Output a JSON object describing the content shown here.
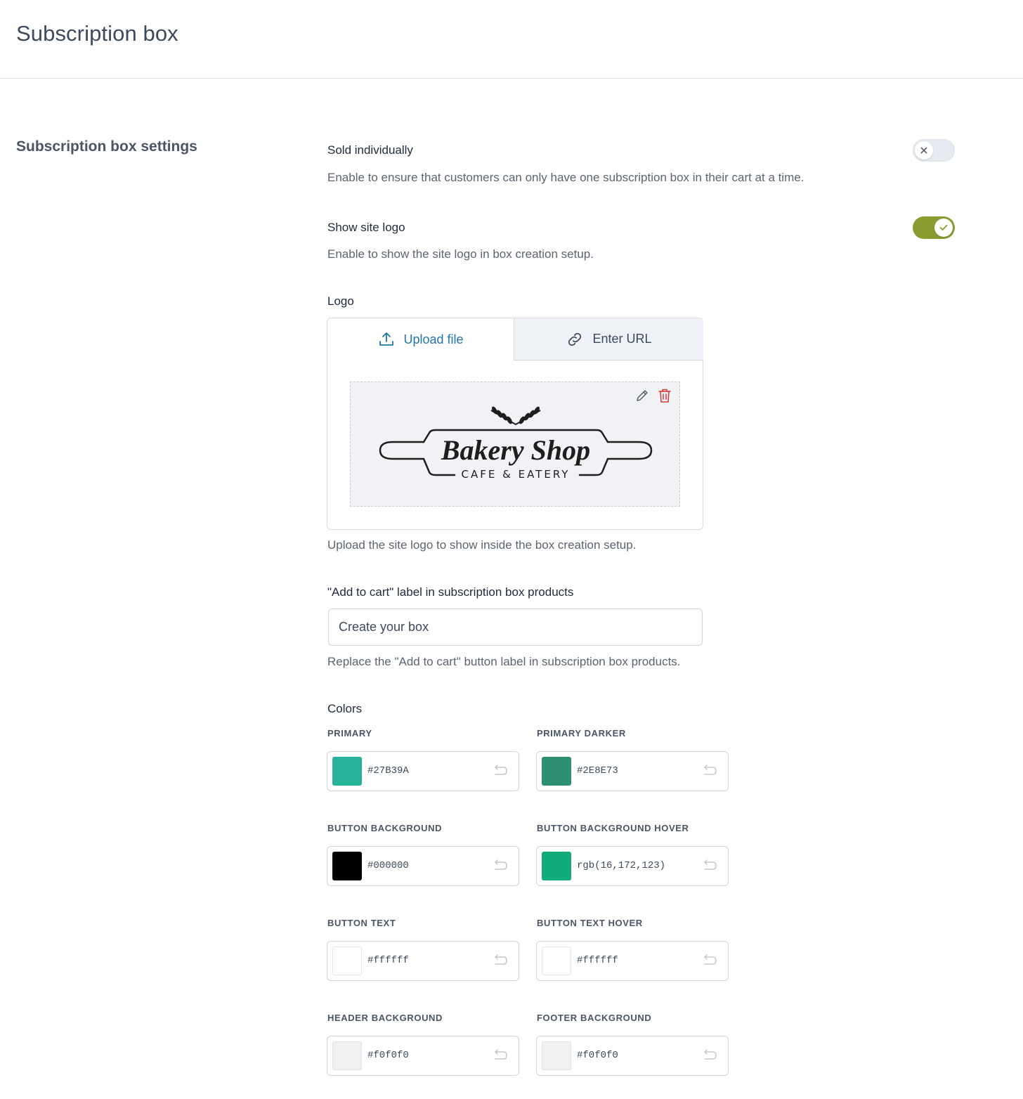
{
  "page": {
    "title": "Subscription box"
  },
  "section": {
    "title": "Subscription box settings"
  },
  "sold_individually": {
    "label": "Sold individually",
    "description": "Enable to ensure that customers can only have one subscription box in their cart at a time.",
    "enabled": false
  },
  "show_site_logo": {
    "label": "Show site logo",
    "description": "Enable to show the site logo in box creation setup.",
    "enabled": true
  },
  "logo": {
    "label": "Logo",
    "tabs": {
      "upload": "Upload file",
      "url": "Enter URL"
    },
    "image": {
      "line1": "Bakery Shop",
      "line2": "CAFE & EATERY"
    },
    "description": "Upload the site logo to show inside the box creation setup."
  },
  "add_to_cart": {
    "label": "\"Add to cart\" label in subscription box products",
    "value": "Create your box",
    "description": "Replace the \"Add to cart\" button label in subscription box products."
  },
  "colors": {
    "label": "Colors",
    "items": [
      {
        "label": "PRIMARY",
        "value": "#27B39A",
        "swatch": "#27B39A"
      },
      {
        "label": "PRIMARY DARKER",
        "value": "#2E8E73",
        "swatch": "#2E8E73"
      },
      {
        "label": "BUTTON BACKGROUND",
        "value": "#000000",
        "swatch": "#000000"
      },
      {
        "label": "BUTTON BACKGROUND HOVER",
        "value": "rgb(16,172,123)",
        "swatch": "#10AC7B"
      },
      {
        "label": "BUTTON TEXT",
        "value": "#ffffff",
        "swatch": "#ffffff"
      },
      {
        "label": "BUTTON TEXT HOVER",
        "value": "#ffffff",
        "swatch": "#ffffff"
      },
      {
        "label": "HEADER BACKGROUND",
        "value": "#f0f0f0",
        "swatch": "#f0f0f0"
      },
      {
        "label": "FOOTER BACKGROUND",
        "value": "#f0f0f0",
        "swatch": "#f0f0f0"
      }
    ]
  },
  "theme": {
    "toggle_on": "#8a9b2f",
    "link": "#1f75a8",
    "delete": "#d63638"
  }
}
